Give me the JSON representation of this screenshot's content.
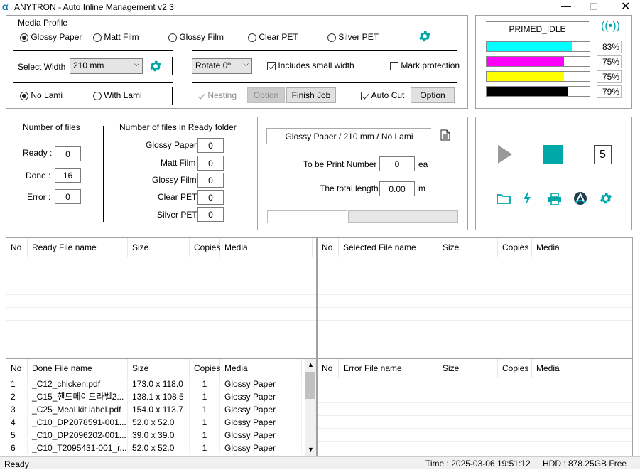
{
  "window": {
    "title": "ANYTRON - Auto Inline Management v2.3"
  },
  "media_profile": {
    "label": "Media Profile",
    "options": [
      "Glossy Paper",
      "Matt Film",
      "Glossy Film",
      "Clear PET",
      "Silver PET"
    ],
    "selected": "Glossy Paper"
  },
  "width": {
    "label": "Select Width",
    "value": "210 mm",
    "rotate": "Rotate 0º",
    "small_width_label": "Includes small width",
    "mark_protection_label": "Mark protection"
  },
  "lami": {
    "no_lami": "No Lami",
    "with_lami": "With Lami",
    "nesting": "Nesting",
    "option_disabled": "Option",
    "finish_job": "Finish Job",
    "auto_cut": "Auto Cut",
    "option": "Option"
  },
  "status_panel": {
    "state": "PRIMED_IDLE",
    "inks": [
      {
        "color": "#00ffff",
        "level": 83,
        "text": "83%"
      },
      {
        "color": "#ff00ff",
        "level": 75,
        "text": "75%"
      },
      {
        "color": "#ffff00",
        "level": 75,
        "text": "75%"
      },
      {
        "color": "#000000",
        "level": 79,
        "text": "79%"
      }
    ]
  },
  "files": {
    "title": "Number of files",
    "ready_label": "Ready :",
    "ready": "0",
    "done_label": "Done :",
    "done": "16",
    "error_label": "Error :",
    "error": "0",
    "folder_title": "Number of files in Ready folder",
    "folder": [
      {
        "label": "Glossy Paper",
        "count": "0"
      },
      {
        "label": "Matt Film",
        "count": "0"
      },
      {
        "label": "Glossy Film",
        "count": "0"
      },
      {
        "label": "Clear PET",
        "count": "0"
      },
      {
        "label": "Silver PET",
        "count": "0"
      }
    ]
  },
  "job": {
    "profile": "Glossy Paper / 210 mm / No Lami",
    "print_number_label": "To be Print Number",
    "print_number": "0",
    "print_unit": "ea",
    "length_label": "The total length",
    "length": "0.00",
    "length_unit": "m"
  },
  "controls": {
    "counter": "5"
  },
  "tables": {
    "ready": {
      "headers": [
        "No",
        "Ready File name",
        "Size",
        "Copies",
        "Media"
      ],
      "rows": []
    },
    "selected": {
      "headers": [
        "No",
        "Selected File name",
        "Size",
        "Copies",
        "Media"
      ],
      "rows": []
    },
    "done": {
      "headers": [
        "No",
        "Done File name",
        "Size",
        "Copies",
        "Media"
      ],
      "rows": [
        [
          "1",
          "_C12_chicken.pdf",
          "173.0 x 118.0",
          "1",
          "Glossy Paper"
        ],
        [
          "2",
          "_C15_핸드메이드라벨2...",
          "138.1 x 108.5",
          "1",
          "Glossy Paper"
        ],
        [
          "3",
          "_C25_Meal kit label.pdf",
          "154.0 x 113.7",
          "1",
          "Glossy Paper"
        ],
        [
          "4",
          "_C10_DP2078591-001...",
          "52.0 x 52.0",
          "1",
          "Glossy Paper"
        ],
        [
          "5",
          "_C10_DP2096202-001...",
          "39.0 x 39.0",
          "1",
          "Glossy Paper"
        ],
        [
          "6",
          "_C10_T2095431-001_r...",
          "52.0 x 52.0",
          "1",
          "Glossy Paper"
        ]
      ]
    },
    "error": {
      "headers": [
        "No",
        "Error File name",
        "Size",
        "Copies",
        "Media"
      ],
      "rows": []
    }
  },
  "statusbar": {
    "left": "Ready",
    "time": "Time : 2025-03-06 19:51:12",
    "hdd": "HDD : 878.25GB Free"
  },
  "colors": {
    "accent": "#00a8a8"
  }
}
